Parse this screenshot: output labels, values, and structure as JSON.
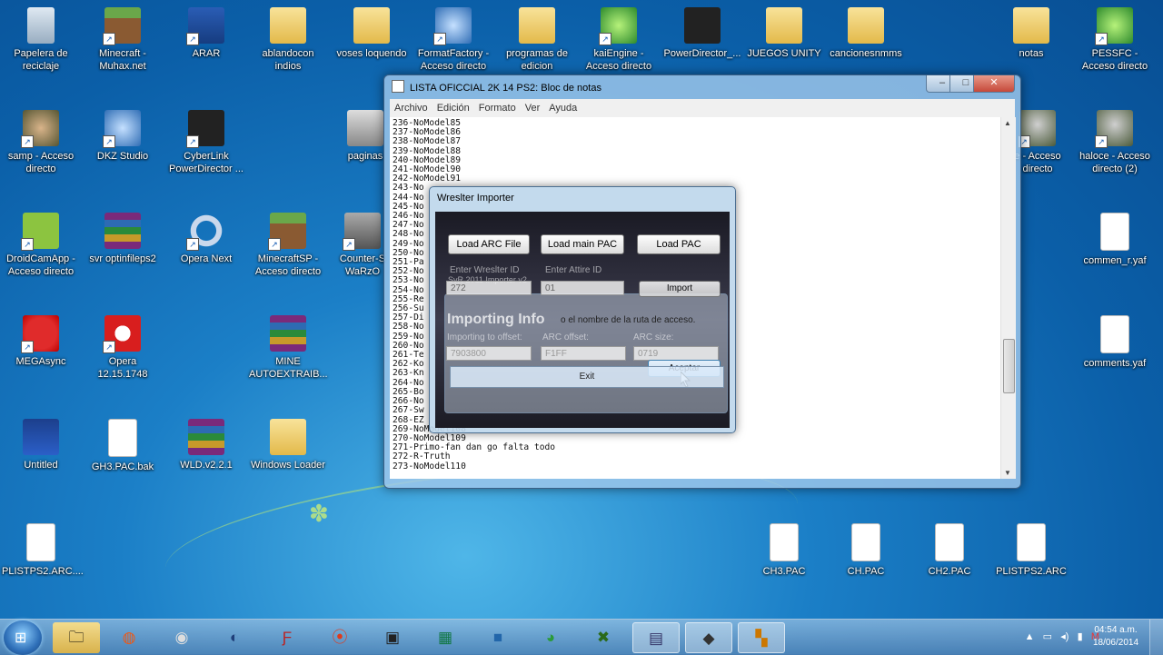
{
  "desktop": {
    "icons": [
      {
        "label": "Papelera de reciclaje"
      },
      {
        "label": "Minecraft - Muhax.net"
      },
      {
        "label": "ARAR"
      },
      {
        "label": "ablandocon indios"
      },
      {
        "label": "voses loquendo"
      },
      {
        "label": "FormatFactory - Acceso directo"
      },
      {
        "label": "programas de edicion"
      },
      {
        "label": "kaiEngine - Acceso directo"
      },
      {
        "label": "PowerDirector_..."
      },
      {
        "label": "JUEGOS UNITY"
      },
      {
        "label": "cancionesnmms"
      },
      {
        "label": "notas"
      },
      {
        "label": "PESSFC - Acceso directo"
      },
      {
        "label": "samp - Acceso directo"
      },
      {
        "label": "DKZ Studio"
      },
      {
        "label": "CyberLink PowerDirector ..."
      },
      {
        "label": "paginas"
      },
      {
        "label": "e - Acceso directo"
      },
      {
        "label": "haloce - Acceso directo (2)"
      },
      {
        "label": "DroidCamApp - Acceso directo"
      },
      {
        "label": "svr optinfileps2"
      },
      {
        "label": "Opera Next"
      },
      {
        "label": "MinecraftSP - Acceso directo"
      },
      {
        "label": "Counter-S WaRzO"
      },
      {
        "label": "commen_r.yaf"
      },
      {
        "label": "MEGAsync"
      },
      {
        "label": "Opera 12.15.1748"
      },
      {
        "label": "MINE AUTOEXTRAIB..."
      },
      {
        "label": "comments.yaf"
      },
      {
        "label": "Untitled"
      },
      {
        "label": "GH3.PAC.bak"
      },
      {
        "label": "WLD.v2.2.1"
      },
      {
        "label": "Windows Loader"
      },
      {
        "label": "PLISTPS2.ARC...."
      },
      {
        "label": "CH3.PAC"
      },
      {
        "label": "CH.PAC"
      },
      {
        "label": "CH2.PAC"
      },
      {
        "label": "PLISTPS2.ARC"
      }
    ]
  },
  "notepad": {
    "title": "LISTA OFICCIAL 2K 14 PS2: Bloc de notas",
    "menu": [
      "Archivo",
      "Edición",
      "Formato",
      "Ver",
      "Ayuda"
    ],
    "lines": [
      "236-NoModel85",
      "237-NoModel86",
      "238-NoModel87",
      "239-NoModel88",
      "240-NoModel89",
      "241-NoModel90",
      "242-NoModel91",
      "243-No",
      "244-No",
      "245-No",
      "246-No",
      "247-No",
      "248-No",
      "249-No",
      "250-No",
      "251-Pa",
      "252-No",
      "253-No",
      "254-No",
      "255-Re",
      "256-Su",
      "257-Di",
      "258-No",
      "259-No",
      "260-No",
      "261-Te",
      "262-Ko",
      "263-Kn",
      "264-No",
      "265-Bo",
      "266-No",
      "267-Sw",
      "268-EZ",
      "269-NoModel108",
      "270-NoModel109",
      "271-Primo-fan dan go falta todo",
      "272-R-Truth",
      "273-NoModel110"
    ]
  },
  "importer": {
    "title": "Wreslter Importer",
    "load_arc": "Load ARC File",
    "load_main": "Load main PAC",
    "load_pac": "Load PAC",
    "wrestler_id_label": "Enter Wreslter ID",
    "attire_id_label": "Enter Attire ID",
    "wrestler_id_value": "272",
    "attire_id_value": "01",
    "import_label": "Import",
    "ghost_title": "SvR 2011 Importer v2",
    "info_heading": "Importing Info",
    "ruta_text": "o el nombre de la ruta de acceso.",
    "offset_label": "Importing to offset:",
    "arc_offset_label": "ARC offset:",
    "arc_size_label": "ARC size:",
    "offset_value": "7903800",
    "arc_offset_value": "F1FF",
    "arc_size_value": "0719",
    "accept_label": "Aceptar",
    "exit_label": "Exit"
  },
  "taskbar": {
    "clock_time": "04:54 a.m.",
    "clock_date": "18/06/2014"
  }
}
